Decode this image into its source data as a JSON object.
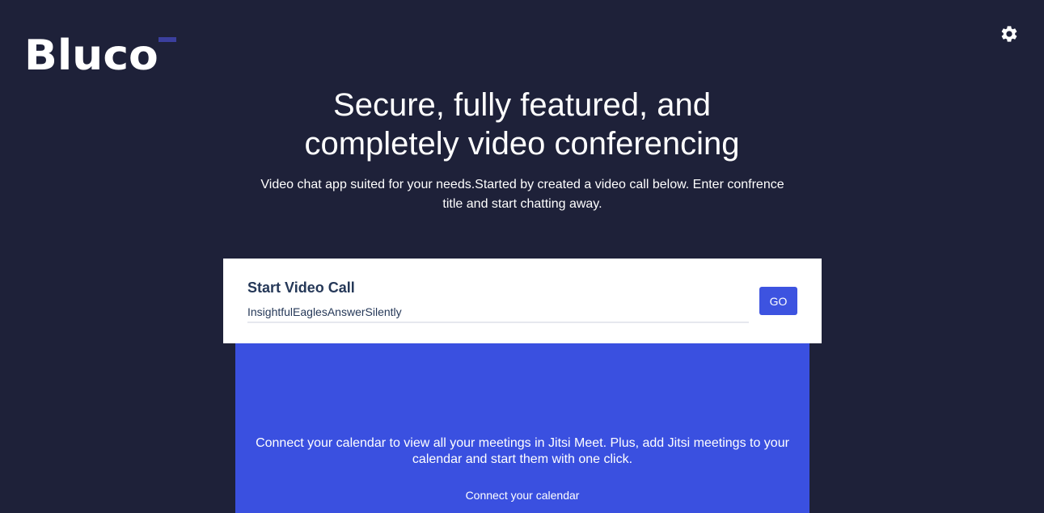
{
  "header": {
    "logo_text": "Bluco",
    "settings_icon": "gear-icon"
  },
  "hero": {
    "title_line1": "Secure, fully featured, and",
    "title_line2": "completely video conferencing",
    "subtitle": "Video chat app suited for your needs.Started by created a video call below. Enter confrence title and start chatting away."
  },
  "start_call": {
    "title": "Start Video Call",
    "room_name": "InsightfulEaglesAnswerSilently",
    "go_label": "GO"
  },
  "calendar": {
    "description": "Connect your calendar to view all your meetings in Jitsi Meet. Plus, add Jitsi meetings to your calendar and start them with one click.",
    "connect_label": "Connect your calendar"
  },
  "colors": {
    "background": "#1e2139",
    "accent": "#3d53e0",
    "panel": "#3a50e0"
  }
}
